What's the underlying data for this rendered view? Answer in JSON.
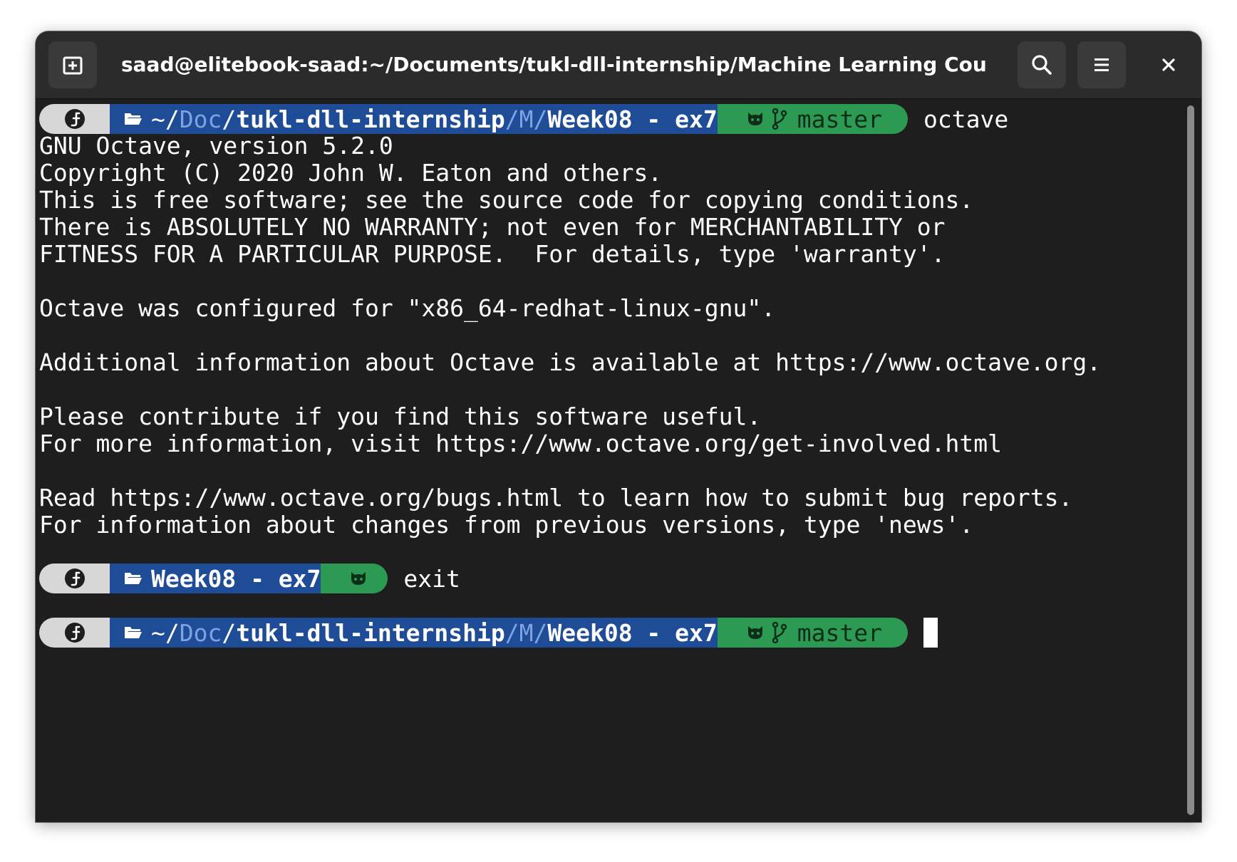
{
  "window": {
    "title": "saad@elitebook-saad:~/Documents/tukl-dll-internship/Machine Learning Course/Wee…",
    "buttons": [
      {
        "name": "new-tab-button",
        "icon": "new-tab-icon"
      },
      {
        "name": "search-button",
        "icon": "search-icon"
      },
      {
        "name": "menu-button",
        "icon": "hamburger-menu-icon"
      },
      {
        "name": "close-button",
        "icon": "close-icon"
      }
    ]
  },
  "prompt_full": {
    "tilde": "~/",
    "doc": "Doc",
    "sep1": "/",
    "repo": "tukl-dll-internship",
    "sep2": "/",
    "m": "M",
    "sep3": "/",
    "dir": "Week08 - ex7",
    "branch": "master"
  },
  "prompt_short": {
    "dir": "Week08 - ex7"
  },
  "commands": {
    "first": "octave",
    "second": "exit"
  },
  "output": [
    "GNU Octave, version 5.2.0",
    "Copyright (C) 2020 John W. Eaton and others.",
    "This is free software; see the source code for copying conditions.",
    "There is ABSOLUTELY NO WARRANTY; not even for MERCHANTABILITY or",
    "FITNESS FOR A PARTICULAR PURPOSE.  For details, type 'warranty'.",
    "Octave was configured for \"x86_64-redhat-linux-gnu\".",
    "Additional information about Octave is available at https://www.octave.org.",
    "Please contribute if you find this software useful.",
    "For more information, visit https://www.octave.org/get-involved.html",
    "Read https://www.octave.org/bugs.html to learn how to submit bug reports.",
    "For information about changes from previous versions, type 'news'."
  ],
  "colors": {
    "background": "#1e1e1e",
    "titlebar": "#2b2b2b",
    "os_segment": "#d7d7d7",
    "dir_segment": "#1f4c96",
    "git_segment": "#2d9a54",
    "text": "#ffffff"
  }
}
